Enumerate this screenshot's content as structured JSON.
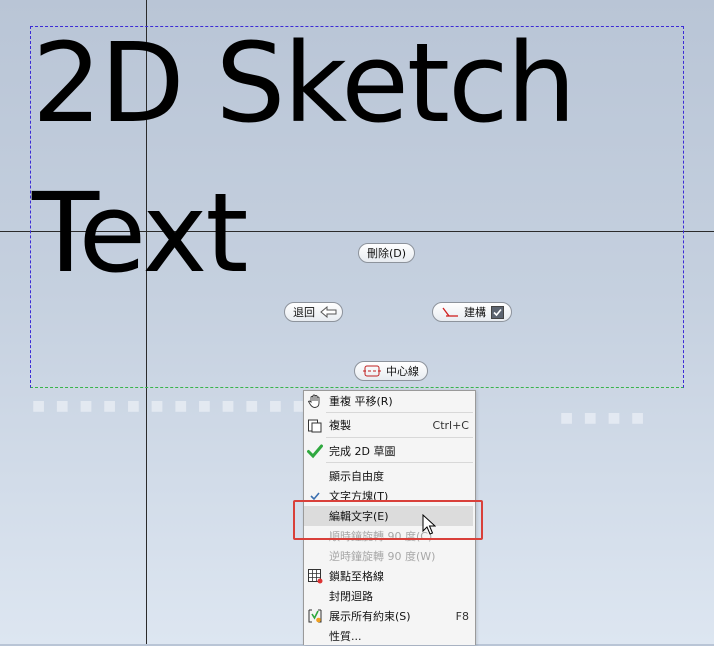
{
  "sketch": {
    "text": "2D Sketch\nText"
  },
  "pills": {
    "delete": "刪除(D)",
    "back": "退回",
    "create": "建構",
    "centerline": "中心線"
  },
  "faint_text": {
    "line1": "■ ■ ■ ■ ■ ■ ■ ■ ■ ■ ■ ■ ■ ■",
    "line2": "■ ■ ■ ■"
  },
  "menu": {
    "items": [
      {
        "label": "重複 平移(R)",
        "icon": "hand-icon"
      },
      {
        "label": "複製",
        "shortcut": "Ctrl+C",
        "icon": "copy-icon"
      },
      {
        "label": "完成 2D 草圖",
        "icon": "check-green-icon"
      },
      {
        "label": "顯示自由度"
      },
      {
        "label": "文字方塊(T)",
        "icon": "checkmark-icon"
      },
      {
        "label": "編輯文字(E)"
      },
      {
        "label": "順時鐘旋轉 90 度(C)",
        "disabled": true
      },
      {
        "label": "逆時鐘旋轉 90 度(W)",
        "disabled": true
      },
      {
        "label": "鎖點至格線",
        "icon": "grid-snap-icon"
      },
      {
        "label": "封閉迴路"
      },
      {
        "label": "展示所有約束(S)",
        "shortcut": "F8",
        "icon": "constraint-icon"
      },
      {
        "label": "性質..."
      }
    ]
  },
  "colors": {
    "selection_box": "#3b2bd6",
    "highlight_box": "#d9403a",
    "check_green": "#2fa83f"
  }
}
